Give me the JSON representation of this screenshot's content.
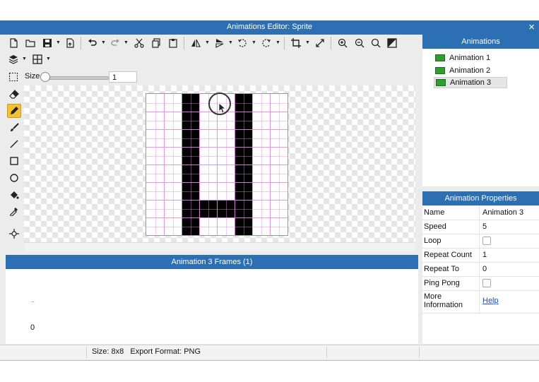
{
  "window": {
    "title": "Animations Editor: Sprite",
    "close_glyph": "×"
  },
  "toolbar": {
    "icons": [
      "new-file-icon",
      "open-folder-icon",
      "save-icon",
      "export-icon",
      "undo-icon",
      "redo-icon",
      "cut-icon",
      "copy-icon",
      "paste-icon",
      "flip-horizontal-icon",
      "flip-vertical-icon",
      "rotate-left-icon",
      "rotate-right-icon",
      "crop-icon",
      "resize-icon",
      "zoom-in-icon",
      "zoom-out-icon",
      "zoom-fit-icon",
      "fill-toggle-icon",
      "layers-icon",
      "grid-icon"
    ]
  },
  "size_control": {
    "label": "Size",
    "value": "1",
    "slider_level": 0.0
  },
  "left_tools": [
    "select-rectangle-icon",
    "eraser-icon",
    "pencil-icon",
    "brush-icon",
    "line-icon",
    "rectangle-icon",
    "ellipse-icon",
    "fill-bucket-icon",
    "eyedropper-icon",
    "pivot-icon"
  ],
  "active_tool": "pencil-icon",
  "sprite": {
    "grid_size": 8,
    "pixels": [
      [
        0,
        0,
        1,
        0,
        0,
        1,
        0,
        0
      ],
      [
        0,
        0,
        1,
        0,
        0,
        1,
        0,
        0
      ],
      [
        0,
        0,
        1,
        0,
        0,
        1,
        0,
        0
      ],
      [
        0,
        0,
        1,
        0,
        0,
        1,
        0,
        0
      ],
      [
        0,
        0,
        1,
        0,
        0,
        1,
        0,
        0
      ],
      [
        0,
        0,
        1,
        0,
        0,
        1,
        0,
        0
      ],
      [
        0,
        0,
        1,
        1,
        1,
        1,
        0,
        0
      ],
      [
        0,
        0,
        1,
        0,
        0,
        1,
        0,
        0
      ]
    ],
    "pixel_color": "#000000",
    "grid_color": "#e58ae5"
  },
  "frames": {
    "title": "Animation 3 Frames (1)",
    "dots": "..",
    "frame_number": "0"
  },
  "animations": {
    "title": "Animations",
    "items": [
      "Animation 1",
      "Animation 2",
      "Animation 3"
    ],
    "selected_index": 2
  },
  "properties": {
    "title": "Animation Properties",
    "rows": [
      {
        "name": "Name",
        "value": "Animation 3",
        "type": "text"
      },
      {
        "name": "Speed",
        "value": "5",
        "type": "text"
      },
      {
        "name": "Loop",
        "value": "",
        "type": "checkbox"
      },
      {
        "name": "Repeat Count",
        "value": "1",
        "type": "text"
      },
      {
        "name": "Repeat To",
        "value": "0",
        "type": "text"
      },
      {
        "name": "Ping Pong",
        "value": "",
        "type": "checkbox"
      },
      {
        "name": "More Information",
        "value": "Help",
        "type": "link"
      }
    ]
  },
  "status": {
    "text": "Size: 8x8   Export Format: PNG"
  },
  "colors": {
    "accent": "#2c6fb3",
    "active_tool": "#f2c230",
    "anim_icon": "#2f9e2f"
  }
}
